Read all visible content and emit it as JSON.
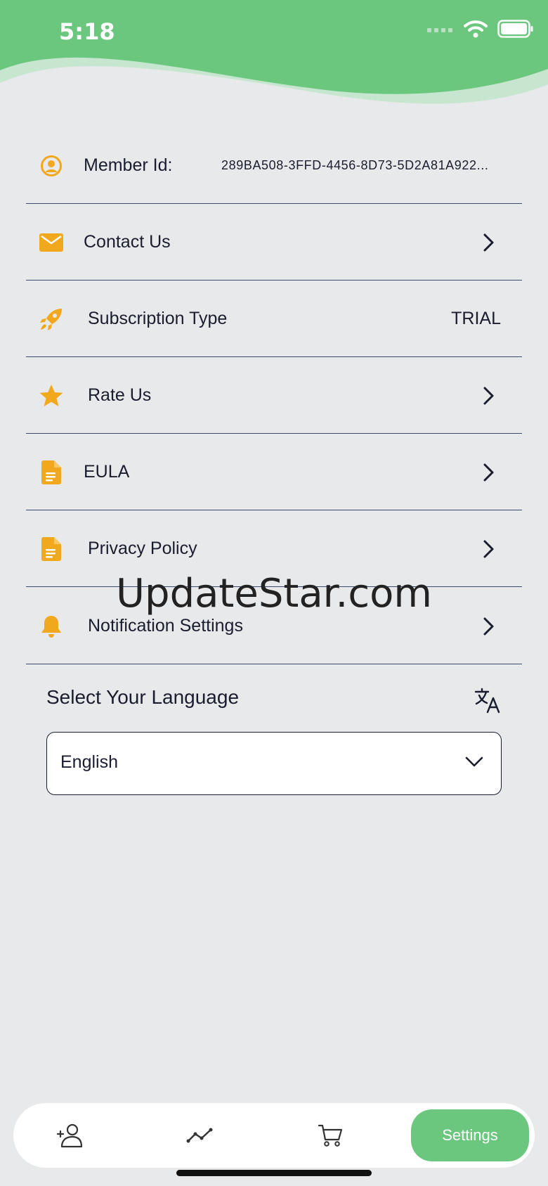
{
  "status_bar": {
    "time": "5:18"
  },
  "settings": {
    "member_id_label": "Member Id:",
    "member_id_value": "289BA508-3FFD-4456-8D73-5D2A81A922...",
    "contact_label": "Contact Us",
    "subscription_label": "Subscription Type",
    "subscription_value": "TRIAL",
    "rate_label": "Rate Us",
    "eula_label": "EULA",
    "privacy_label": "Privacy Policy",
    "notification_label": "Notification Settings"
  },
  "language": {
    "title": "Select Your Language",
    "selected": "English"
  },
  "watermark": "UpdateStar.com",
  "tabbar": {
    "active_label": "Settings"
  },
  "colors": {
    "header_green": "#6cc77e",
    "icon_orange": "#f2a81d",
    "divider": "#3b4a6b",
    "background": "#e8e9eb"
  },
  "icons": {
    "member": "user-circle-icon",
    "contact": "envelope-icon",
    "subscription": "rocket-icon",
    "rate": "star-icon",
    "eula": "document-icon",
    "privacy": "document-icon",
    "notification": "bell-icon",
    "language": "translate-icon",
    "tab_1": "add-user-icon",
    "tab_2": "chart-line-icon",
    "tab_3": "cart-icon"
  }
}
